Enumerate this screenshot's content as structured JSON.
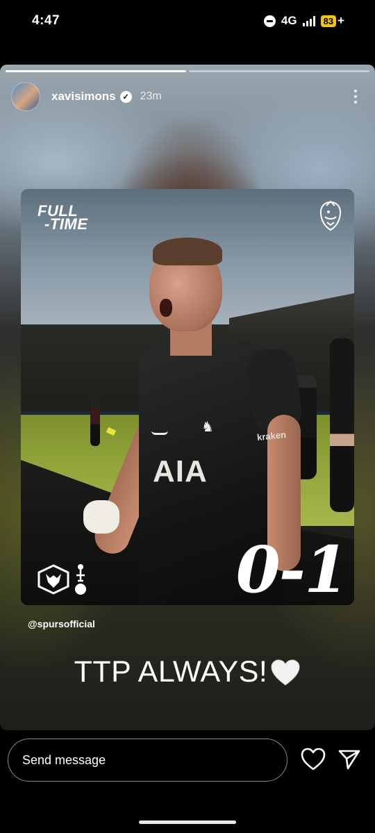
{
  "status_bar": {
    "time": "4:47",
    "network": "4G",
    "battery": "83",
    "battery_suffix": "+"
  },
  "story": {
    "progress": [
      {
        "fill": 1.0
      },
      {
        "fill": 0.0
      }
    ],
    "user": {
      "username": "xavisimons",
      "verified": true,
      "timestamp": "23m"
    },
    "post": {
      "headline_line1": "FULL",
      "headline_line2": "-TIME",
      "score": "0-1",
      "sponsor_text": "AIA",
      "kit_sponsor": "kraken",
      "league_icon": "premier-league-lion-icon",
      "home_badge_icon": "wolves-badge-icon",
      "away_badge_icon": "spurs-badge-icon"
    },
    "mention": "@spursofficial",
    "caption": "TTP ALWAYS!",
    "caption_emoji": "white-heart-icon"
  },
  "reply_bar": {
    "placeholder": "Send message"
  },
  "colors": {
    "battery": "#f1c40f",
    "background": "#000000"
  }
}
